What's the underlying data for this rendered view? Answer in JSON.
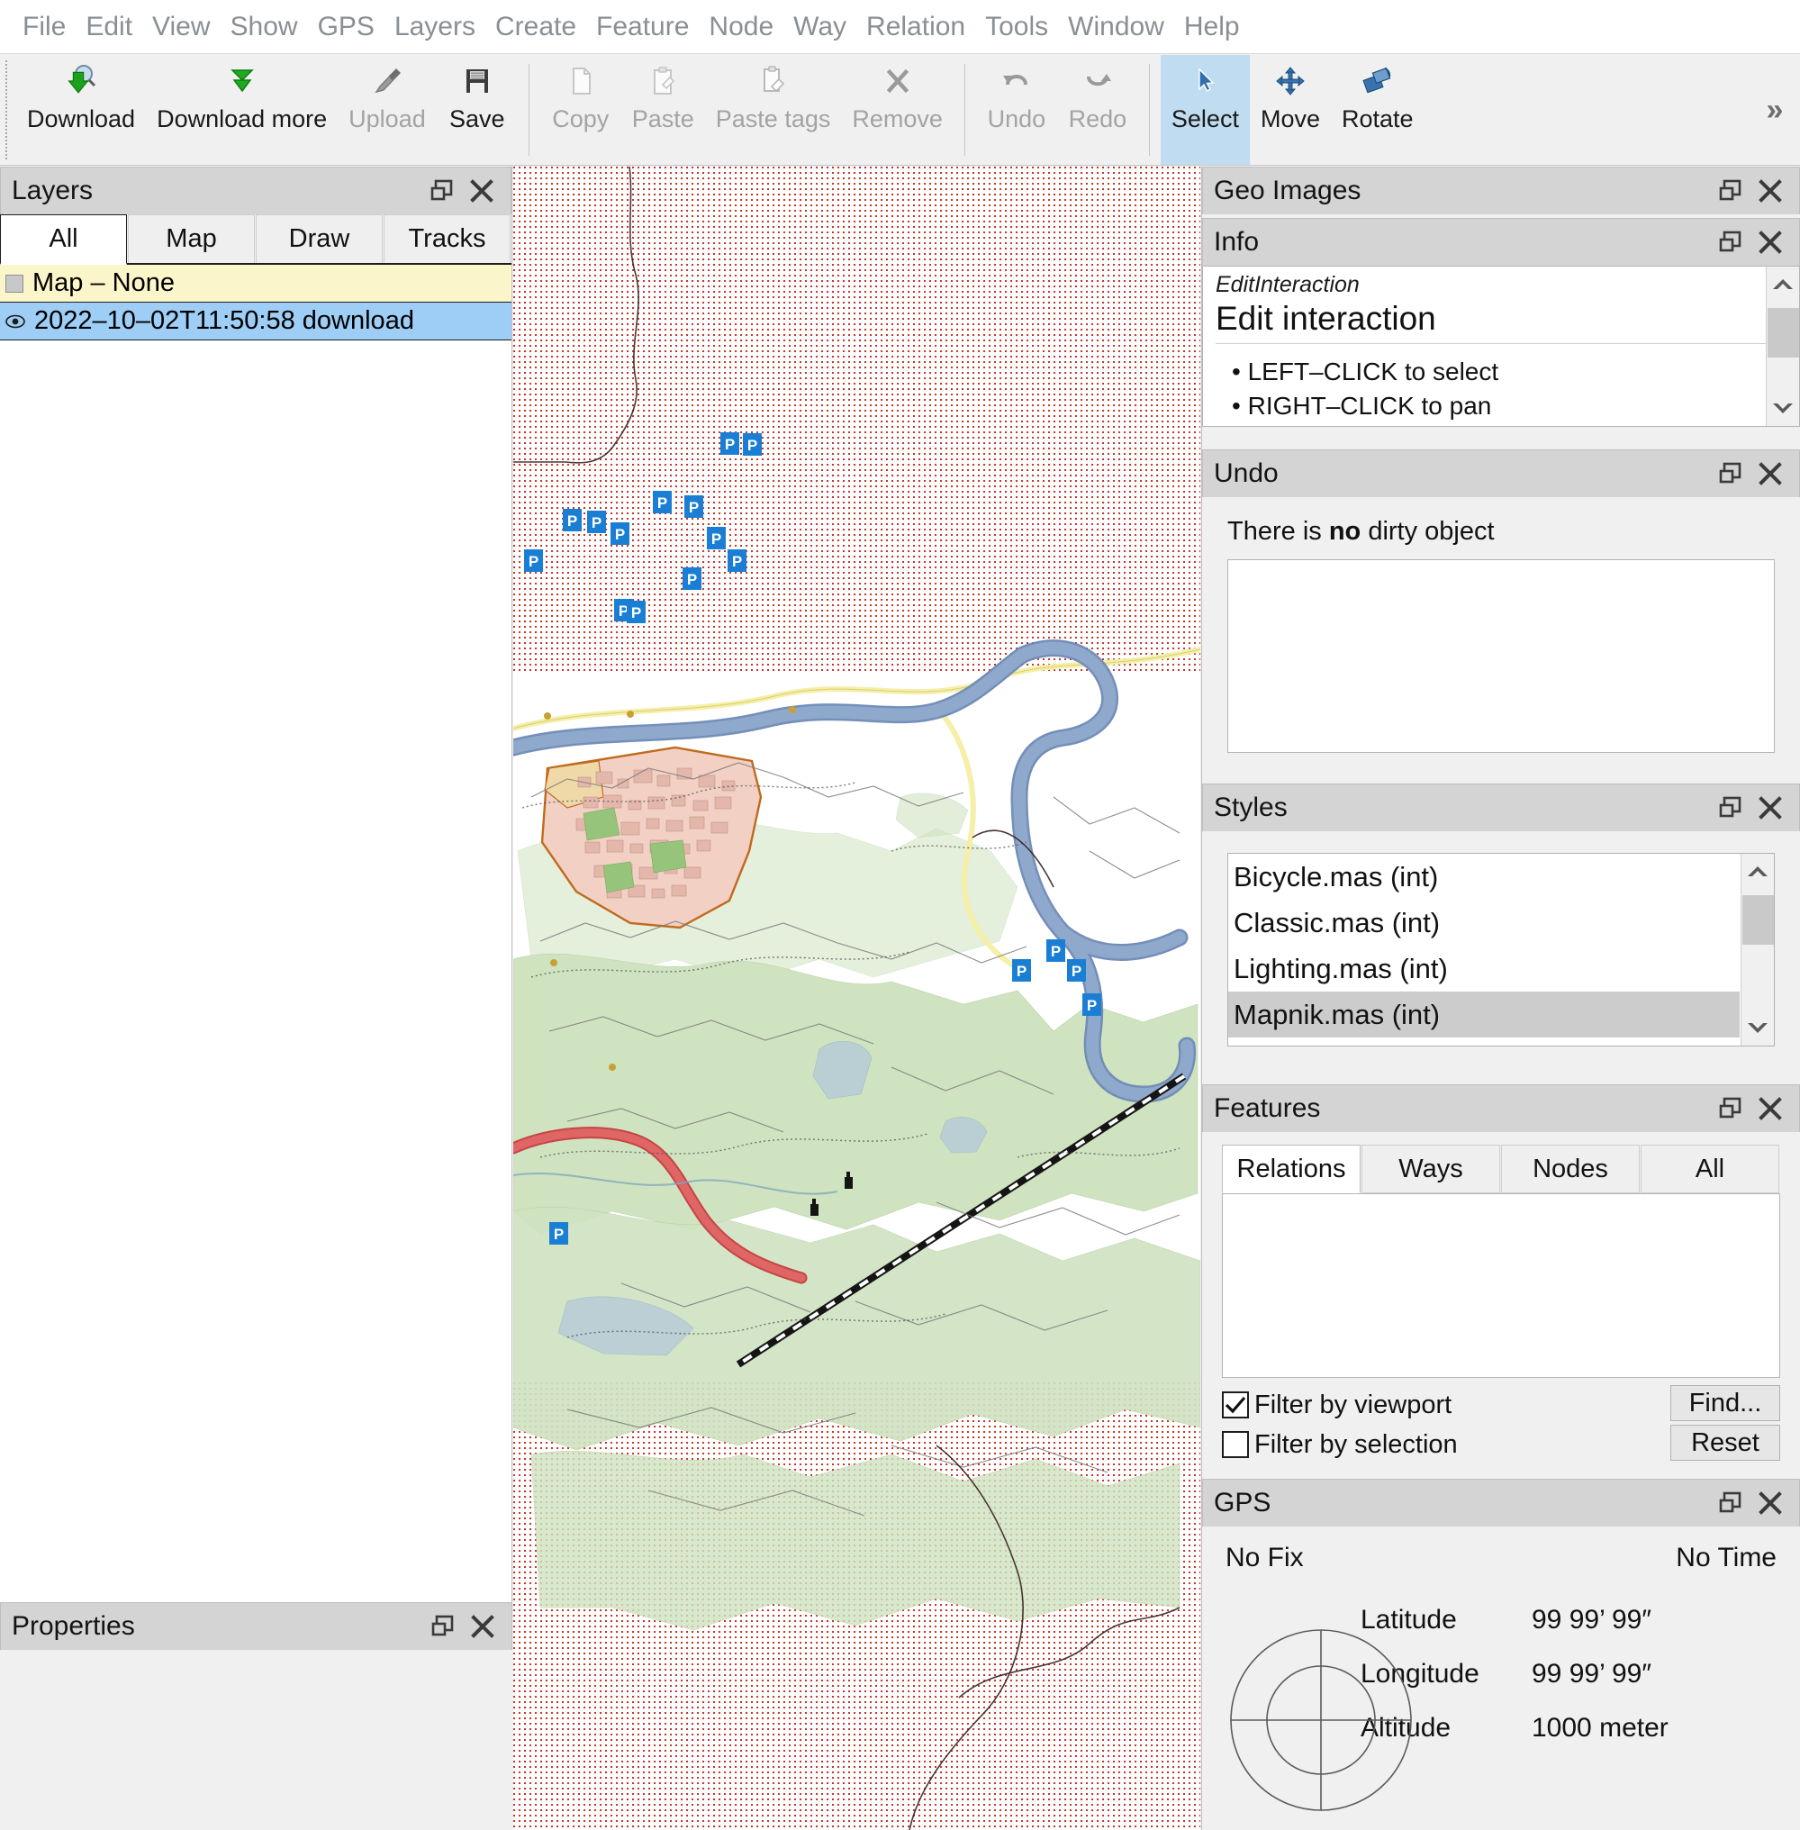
{
  "menubar": {
    "items": [
      {
        "label": "File"
      },
      {
        "label": "Edit"
      },
      {
        "label": "View"
      },
      {
        "label": "Show"
      },
      {
        "label": "GPS"
      },
      {
        "label": "Layers"
      },
      {
        "label": "Create"
      },
      {
        "label": "Feature"
      },
      {
        "label": "Node"
      },
      {
        "label": "Way"
      },
      {
        "label": "Relation"
      },
      {
        "label": "Tools"
      },
      {
        "label": "Window"
      },
      {
        "label": "Help"
      }
    ]
  },
  "toolbar": {
    "overflow_label": "»",
    "groups": [
      {
        "buttons": [
          {
            "label": "Download",
            "icon": "download-search-icon",
            "enabled": true,
            "active": false
          },
          {
            "label": "Download more",
            "icon": "download-more-icon",
            "enabled": true,
            "active": false
          },
          {
            "label": "Upload",
            "icon": "upload-megaphone-icon",
            "enabled": false,
            "active": false
          },
          {
            "label": "Save",
            "icon": "floppy-disk-icon",
            "enabled": true,
            "active": false
          }
        ]
      },
      {
        "buttons": [
          {
            "label": "Copy",
            "icon": "copy-document-icon",
            "enabled": false,
            "active": false
          },
          {
            "label": "Paste",
            "icon": "paste-clipboard-icon",
            "enabled": false,
            "active": false
          },
          {
            "label": "Paste tags",
            "icon": "paste-tags-icon",
            "enabled": false,
            "active": false
          },
          {
            "label": "Remove",
            "icon": "remove-x-icon",
            "enabled": false,
            "active": false
          }
        ]
      },
      {
        "buttons": [
          {
            "label": "Undo",
            "icon": "undo-arrow-icon",
            "enabled": false,
            "active": false
          },
          {
            "label": "Redo",
            "icon": "redo-arrow-icon",
            "enabled": false,
            "active": false
          }
        ]
      },
      {
        "buttons": [
          {
            "label": "Select",
            "icon": "cursor-arrow-icon",
            "enabled": true,
            "active": true
          },
          {
            "label": "Move",
            "icon": "move-cross-arrows-icon",
            "enabled": true,
            "active": false
          },
          {
            "label": "Rotate",
            "icon": "rotate-squares-icon",
            "enabled": true,
            "active": false
          }
        ]
      }
    ]
  },
  "layers_panel": {
    "title": "Layers",
    "tabs": [
      {
        "label": "All",
        "active": true
      },
      {
        "label": "Map",
        "active": false
      },
      {
        "label": "Draw",
        "active": false
      },
      {
        "label": "Tracks",
        "active": false
      }
    ],
    "rows": [
      {
        "label": "Map – None",
        "state": "yellow",
        "marker": "checkbox"
      },
      {
        "label": "2022–10–02T11:50:58 download",
        "state": "selected",
        "marker": "eye"
      }
    ]
  },
  "properties_panel": {
    "title": "Properties"
  },
  "geo_images_panel": {
    "title": "Geo Images"
  },
  "info_panel": {
    "title": "Info",
    "class_name": "EditInteraction",
    "heading": "Edit interaction",
    "bullets": [
      "LEFT–CLICK to select",
      "RIGHT–CLICK to pan"
    ]
  },
  "undo_panel": {
    "title": "Undo",
    "message_prefix": "There is ",
    "message_bold": "no",
    "message_suffix": " dirty object"
  },
  "styles_panel": {
    "title": "Styles",
    "items": [
      {
        "label": "Bicycle.mas (int)",
        "selected": false
      },
      {
        "label": "Classic.mas (int)",
        "selected": false
      },
      {
        "label": "Lighting.mas (int)",
        "selected": false
      },
      {
        "label": "Mapnik.mas (int)",
        "selected": true
      }
    ]
  },
  "features_panel": {
    "title": "Features",
    "tabs": [
      {
        "label": "Relations",
        "active": true
      },
      {
        "label": "Ways",
        "active": false
      },
      {
        "label": "Nodes",
        "active": false
      },
      {
        "label": "All",
        "active": false
      }
    ],
    "filter_viewport_label": "Filter by viewport",
    "filter_viewport_checked": true,
    "filter_selection_label": "Filter by selection",
    "filter_selection_checked": false,
    "find_label": "Find...",
    "reset_label": "Reset"
  },
  "gps_panel": {
    "title": "GPS",
    "fix_status": "No Fix",
    "time_status": "No Time",
    "fields": [
      {
        "key": "Latitude",
        "value": "99 99’ 99″"
      },
      {
        "key": "Longitude",
        "value": "99 99’ 99″"
      },
      {
        "key": "Altitude",
        "value": "1000 meter"
      }
    ]
  },
  "map": {
    "undownloaded_dot_color": "#c0392b",
    "land_green": "#cfe3c0",
    "urban_pink": "#f2d0c4",
    "building_red": "#e4b7ab",
    "motorway_blue": "#8fa9cd",
    "primary_red": "#e06666",
    "secondary_yellow": "#f5efa8",
    "water_blue": "#b7ccd8",
    "boundary_orange": "#c06a1e",
    "poi_parking_label": "P"
  }
}
